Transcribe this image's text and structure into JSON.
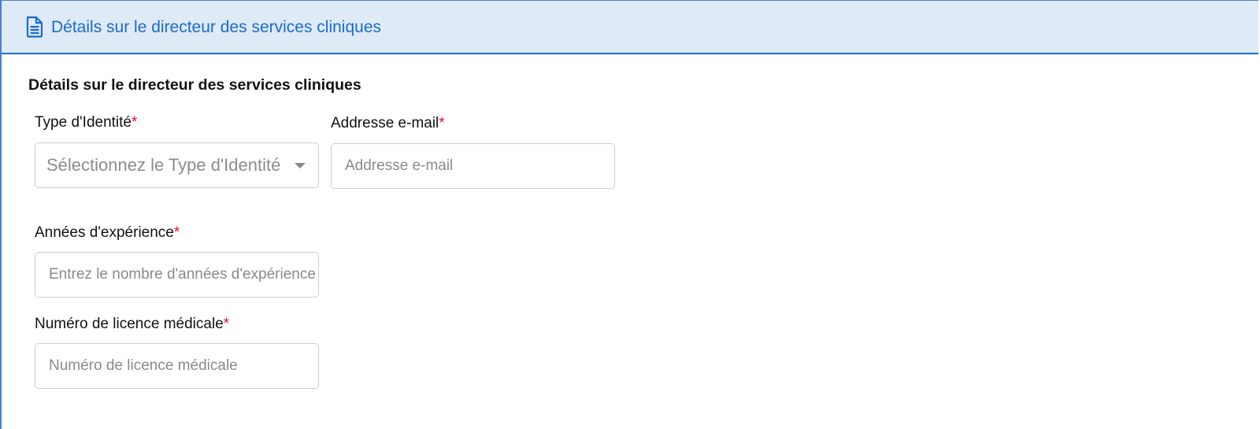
{
  "header": {
    "icon": "document-icon",
    "title": "Détails sur le directeur des services cliniques"
  },
  "section": {
    "title": "Détails sur le directeur des services cliniques"
  },
  "fields": {
    "identity_type": {
      "label": "Type d'Identité",
      "required_mark": "*",
      "placeholder": "Sélectionnez le Type d'Identité",
      "icon": "caret-down-icon"
    },
    "email": {
      "label": "Addresse e-mail",
      "required_mark": "*",
      "placeholder": "Addresse e-mail"
    },
    "experience": {
      "label": "Années d'expérience",
      "required_mark": "*",
      "placeholder": "Entrez le nombre d'années d'expérience"
    },
    "license": {
      "label": "Numéro de licence médicale",
      "required_mark": "*",
      "placeholder": "Numéro de licence médicale"
    }
  },
  "colors": {
    "header_bg": "#deeaf6",
    "accent": "#1a6ad0",
    "required": "#e0102a",
    "border": "#cfcfcf",
    "placeholder": "#8a8a8a"
  }
}
